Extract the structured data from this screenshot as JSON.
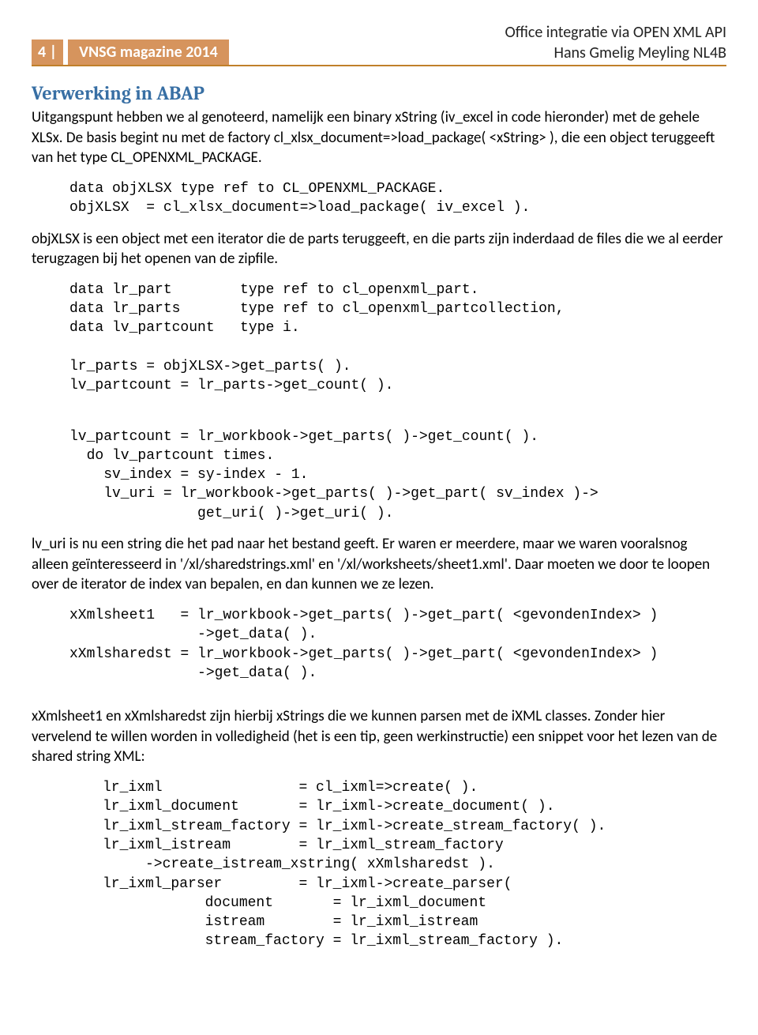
{
  "header": {
    "page_num": "4 |",
    "magazine": "VNSG magazine 2014",
    "right_line1": "Office integratie via OPEN XML API",
    "right_line2": "Hans Gmelig Meyling NL4B"
  },
  "section_title": "Verwerking in ABAP",
  "para1": "Uitgangspunt hebben we al genoteerd, namelijk een binary xString (iv_excel in code hieronder) met de gehele XLSx. De basis begint nu met de factory  cl_xlsx_document=>load_package( <xString> ), die een object teruggeeft van het type CL_OPENXML_PACKAGE.",
  "code1": "data objXLSX type ref to CL_OPENXML_PACKAGE.\nobjXLSX  = cl_xlsx_document=>load_package( iv_excel ).",
  "para2": "objXLSX is een object met een iterator die de parts teruggeeft, en die parts zijn inderdaad de files die we al eerder terugzagen bij het openen van de zipfile.",
  "code2": "data lr_part        type ref to cl_openxml_part.\ndata lr_parts       type ref to cl_openxml_partcollection,\ndata lv_partcount   type i.\n\nlr_parts = objXLSX->get_parts( ).\nlv_partcount = lr_parts->get_count( ).",
  "code3": "lv_partcount = lr_workbook->get_parts( )->get_count( ).\n  do lv_partcount times.\n    sv_index = sy-index - 1.\n    lv_uri = lr_workbook->get_parts( )->get_part( sv_index )->\n               get_uri( )->get_uri( ).",
  "para3": "lv_uri is nu een string die het pad naar het bestand geeft. Er waren er meerdere, maar we waren vooralsnog alleen geïnteresseerd in '/xl/sharedstrings.xml' en  '/xl/worksheets/sheet1.xml'. Daar moeten we door te loopen over de iterator de index van bepalen, en dan kunnen we ze lezen.",
  "code4": "xXmlsheet1   = lr_workbook->get_parts( )->get_part( <gevondenIndex> )\n               ->get_data( ).\nxXmlsharedst = lr_workbook->get_parts( )->get_part( <gevondenIndex> )\n               ->get_data( ).",
  "para4": "xXmlsheet1 en xXmlsharedst zijn hierbij xStrings die we kunnen parsen met de iXML classes. Zonder hier vervelend te willen worden in volledigheid (het is een tip, geen werkinstructie) een snippet voor het lezen van de shared string XML:",
  "code5": "lr_ixml                = cl_ixml=>create( ).\nlr_ixml_document       = lr_ixml->create_document( ).\nlr_ixml_stream_factory = lr_ixml->create_stream_factory( ).\nlr_ixml_istream        = lr_ixml_stream_factory\n     ->create_istream_xstring( xXmlsharedst ).\nlr_ixml_parser         = lr_ixml->create_parser(\n            document       = lr_ixml_document\n            istream        = lr_ixml_istream\n            stream_factory = lr_ixml_stream_factory )."
}
